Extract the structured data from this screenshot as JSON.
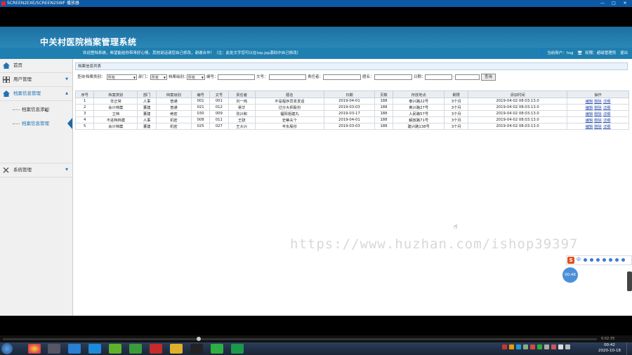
{
  "window": {
    "title": "SCREEN2EXE/SCREEN2SWF 播放器",
    "controls": {
      "minimize": "—",
      "maximize": "□",
      "close": "✕"
    }
  },
  "app": {
    "title": "中关村医院档案管理系统",
    "welcome": "欢迎登陆系统，希望能给你带来好心情，其他说话请您自己修改，谢谢合作！（注：此处文字您可以在top.jsp源码中自己修改）",
    "user_label": "当前用户：hsg",
    "role_label": "权限：超级管理员",
    "logout_label": "退出"
  },
  "sidebar": {
    "items": [
      {
        "label": "首页",
        "icon": "home-icon"
      },
      {
        "label": "用户管理",
        "icon": "grid-icon",
        "arrow": "▼"
      },
      {
        "label": "档案信息管理",
        "icon": "home-icon",
        "arrow": "▲"
      },
      {
        "label": "系统管理",
        "icon": "tools-icon",
        "arrow": "▼"
      }
    ],
    "subitems": [
      {
        "label": "档案信息添加"
      },
      {
        "label": "档案信息管理"
      }
    ]
  },
  "panel": {
    "title": "档案信息列表"
  },
  "filters": {
    "query_label": "查询",
    "type_label": "档案类别：",
    "type_value": "所有",
    "dept_label": "部门：",
    "dept_value": "所有",
    "level_label": "档案级别：",
    "level_value": "所有",
    "number_label": "编号：",
    "doc_label": "文号：",
    "owner_label": "责任者：",
    "title_label": "题名：",
    "date_label": "日期：",
    "search_button": "查询"
  },
  "table": {
    "headers": [
      "序号",
      "档案类别",
      "部门",
      "档案级别",
      "编号",
      "文号",
      "责任者",
      "题名",
      "日期",
      "页数",
      "存放地点",
      "期限",
      "添加时间",
      "操作"
    ],
    "rows": [
      [
        "1",
        "非正常",
        "人事",
        "普通",
        "001",
        "001",
        "刘一鸣",
        "不是程序员发发话",
        "2019-04-01",
        "188",
        "泰兴路22号",
        "3个月",
        "2019-04-02 08:03:13.0"
      ],
      [
        "2",
        "会计档案",
        "董建",
        "普通",
        "021",
        "012",
        "吴华",
        "过分大师股份",
        "2019-03-03",
        "188",
        "黄兴路27号",
        "3个月",
        "2019-04-02 08:03:13.0"
      ],
      [
        "3",
        "立档",
        "董建",
        "绝密",
        "030",
        "009",
        "张兴和",
        "福阳祖建丸",
        "2019-03-17",
        "188",
        "人民路57号",
        "3个月",
        "2019-04-02 08:03:13.0"
      ],
      [
        "4",
        "不进档档案",
        "人事",
        "机密",
        "008",
        "011",
        "王骁",
        "史蒂夫个",
        "2019-04-01",
        "188",
        "解放路71号",
        "3个月",
        "2019-04-02 08:03:13.0"
      ],
      [
        "5",
        "会计档案",
        "董建",
        "机密",
        "025",
        "027",
        "王大兴",
        "丰东股份",
        "2019-03-03",
        "188",
        "建兴路138号",
        "3个月",
        "2019-04-02 08:03:13.0"
      ]
    ],
    "actions": [
      "编辑",
      "删除",
      "详细"
    ]
  },
  "watermark": "https://www.huzhan.com/ishop39397",
  "ime": {
    "logo": "S",
    "mode": "中"
  },
  "timer": "00:48",
  "player": {
    "time": "0:02:35"
  },
  "taskbar": {
    "time": "00:42",
    "date": "2020-10-18"
  }
}
